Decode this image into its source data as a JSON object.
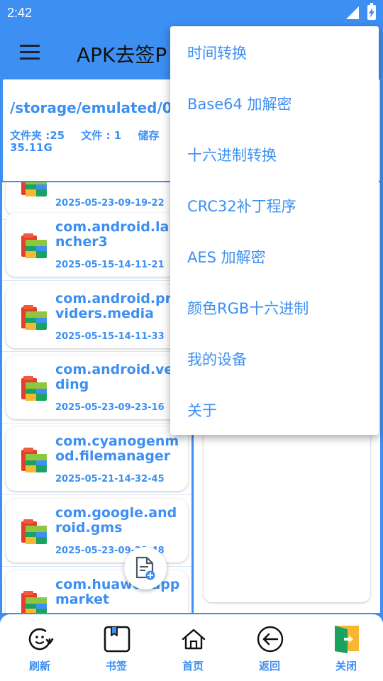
{
  "status_bar": {
    "time": "2:42"
  },
  "app_bar": {
    "title": "APK去签P"
  },
  "path_card": {
    "path": "/storage/emulated/0/",
    "folders": "文件夹 :25",
    "files": "文件 :  1",
    "storage_label": "储存",
    "storage_free": "35.11G"
  },
  "file_list": [
    {
      "name": "",
      "date": "2025-05-23-09-19-22"
    },
    {
      "name": "com.android.launcher3",
      "date": "2025-05-15-14-11-21"
    },
    {
      "name": "com.android.providers.media",
      "date": "2025-05-15-14-11-33"
    },
    {
      "name": "com.android.vending",
      "date": "2025-05-23-09-23-16"
    },
    {
      "name": "com.cyanogenmod.filemanager",
      "date": "2025-05-21-14-32-45"
    },
    {
      "name": "com.google.android.gms",
      "date": "2025-05-23-09-23-48"
    },
    {
      "name": "com.huawei.appmarket",
      "date": ""
    }
  ],
  "bottom_nav": [
    {
      "label": "刷新",
      "icon": "refresh-icon"
    },
    {
      "label": "书签",
      "icon": "bookmark-icon"
    },
    {
      "label": "首页",
      "icon": "home-icon"
    },
    {
      "label": "返回",
      "icon": "back-icon"
    },
    {
      "label": "关闭",
      "icon": "exit-icon"
    }
  ],
  "overflow_menu": [
    {
      "label": "时间转换"
    },
    {
      "label": "Base64 加解密"
    },
    {
      "label": "十六进制转换"
    },
    {
      "label": "CRC32补丁程序"
    },
    {
      "label": "AES 加解密"
    },
    {
      "label": "颜色RGB十六进制"
    },
    {
      "label": "我的设备"
    },
    {
      "label": "关于"
    }
  ],
  "colors": {
    "accent": "#3d8ff2",
    "background": "#ffffff"
  }
}
